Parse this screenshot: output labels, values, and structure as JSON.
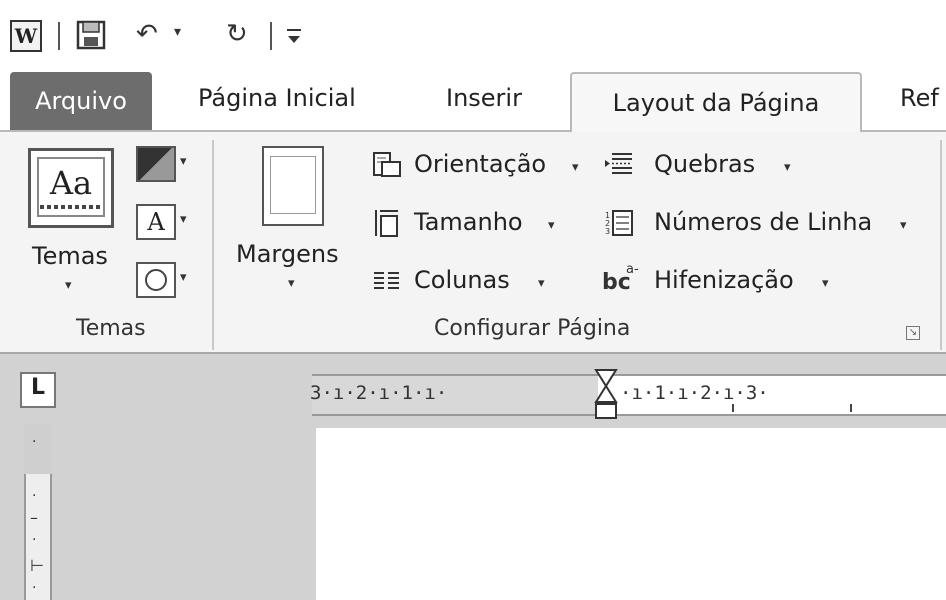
{
  "quick_access": {
    "app_icon": "W",
    "save_icon": "save-icon",
    "undo_icon": "undo-icon",
    "redo_icon": "redo-icon",
    "customize_icon": "customize-qat-icon"
  },
  "tabs": {
    "file": "Arquivo",
    "home": "Página Inicial",
    "insert": "Inserir",
    "page_layout": "Layout da Página",
    "references": "Ref"
  },
  "ribbon": {
    "themes_group": {
      "label": "Temas",
      "themes_button": "Temas",
      "themes_icon_text": "Aa",
      "colors_icon": "theme-colors-icon",
      "fonts_icon_text": "A",
      "effects_icon": "theme-effects-icon"
    },
    "page_setup_group": {
      "label": "Configurar Página",
      "margins": "Margens",
      "orientation": "Orientação",
      "size": "Tamanho",
      "columns": "Colunas",
      "breaks": "Quebras",
      "line_numbers": "Números de Linha",
      "hyphenation": "Hifenização",
      "hyphenation_icon_text": "bc"
    }
  },
  "ruler": {
    "horizontal_left": "3·ı·2·ı·1·ı·",
    "horizontal_right": "·ı·1·ı·2·ı·3·",
    "tab_selector": "L"
  },
  "colors": {
    "file_tab": "#6d6d6d",
    "ribbon_bg": "#f4f4f4",
    "workspace": "#d2d2d2"
  }
}
